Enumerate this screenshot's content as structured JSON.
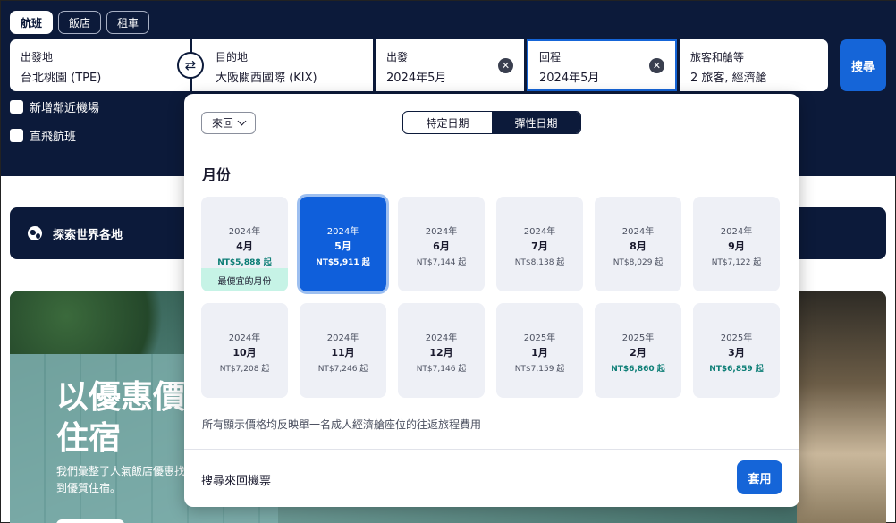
{
  "tabs": [
    {
      "label": "航班",
      "active": true
    },
    {
      "label": "飯店",
      "active": false
    },
    {
      "label": "租車",
      "active": false
    }
  ],
  "search": {
    "origin": {
      "label": "出發地",
      "value": "台北桃園 (TPE)"
    },
    "destination": {
      "label": "目的地",
      "value": "大阪關西國際 (KIX)"
    },
    "depart": {
      "label": "出發",
      "value": "2024年5月"
    },
    "return": {
      "label": "回程",
      "value": "2024年5月"
    },
    "passengers": {
      "label": "旅客和艙等",
      "value": "2 旅客, 經濟艙"
    },
    "swap_icon": "⇄",
    "clear_icon": "✕",
    "search_button": "搜尋"
  },
  "options": {
    "nearby_airports": "新增鄰近機場",
    "direct_flights": "直飛航班"
  },
  "explore": {
    "label": "探索世界各地"
  },
  "hero": {
    "title": "以優惠價住宿",
    "subtitle": "我們彙整了人氣飯店優惠找到優質住宿。"
  },
  "popup": {
    "trip_type": "來回",
    "toggle": {
      "specific": "特定日期",
      "flexible": "彈性日期",
      "active": "flexible"
    },
    "section_title": "月份",
    "months": [
      {
        "year": "2024年",
        "month": "4月",
        "price": "NT$5,888 起",
        "cheap": true,
        "selected": false,
        "badge": "最便宜的月份"
      },
      {
        "year": "2024年",
        "month": "5月",
        "price": "NT$5,911 起",
        "cheap": false,
        "selected": true,
        "badge": ""
      },
      {
        "year": "2024年",
        "month": "6月",
        "price": "NT$7,144 起",
        "cheap": false,
        "selected": false,
        "badge": ""
      },
      {
        "year": "2024年",
        "month": "7月",
        "price": "NT$8,138 起",
        "cheap": false,
        "selected": false,
        "badge": ""
      },
      {
        "year": "2024年",
        "month": "8月",
        "price": "NT$8,029 起",
        "cheap": false,
        "selected": false,
        "badge": ""
      },
      {
        "year": "2024年",
        "month": "9月",
        "price": "NT$7,122 起",
        "cheap": false,
        "selected": false,
        "badge": ""
      },
      {
        "year": "2024年",
        "month": "10月",
        "price": "NT$7,208 起",
        "cheap": false,
        "selected": false,
        "badge": ""
      },
      {
        "year": "2024年",
        "month": "11月",
        "price": "NT$7,246 起",
        "cheap": false,
        "selected": false,
        "badge": ""
      },
      {
        "year": "2024年",
        "month": "12月",
        "price": "NT$7,146 起",
        "cheap": false,
        "selected": false,
        "badge": ""
      },
      {
        "year": "2025年",
        "month": "1月",
        "price": "NT$7,159 起",
        "cheap": false,
        "selected": false,
        "badge": ""
      },
      {
        "year": "2025年",
        "month": "2月",
        "price": "NT$6,860 起",
        "cheap": true,
        "selected": false,
        "badge": ""
      },
      {
        "year": "2025年",
        "month": "3月",
        "price": "NT$6,859 起",
        "cheap": true,
        "selected": false,
        "badge": ""
      }
    ],
    "note": "所有顯示價格均反映單一名成人經濟艙座位的往返旅程費用",
    "footer_link": "搜尋來回機票",
    "apply_button": "套用"
  },
  "colors": {
    "header_bg": "#0c1a3a",
    "accent": "#1565d8",
    "selected_cell": "#0f5fdb",
    "cheap_price": "#0b7d75",
    "cheap_badge": "#c6f3e6"
  }
}
